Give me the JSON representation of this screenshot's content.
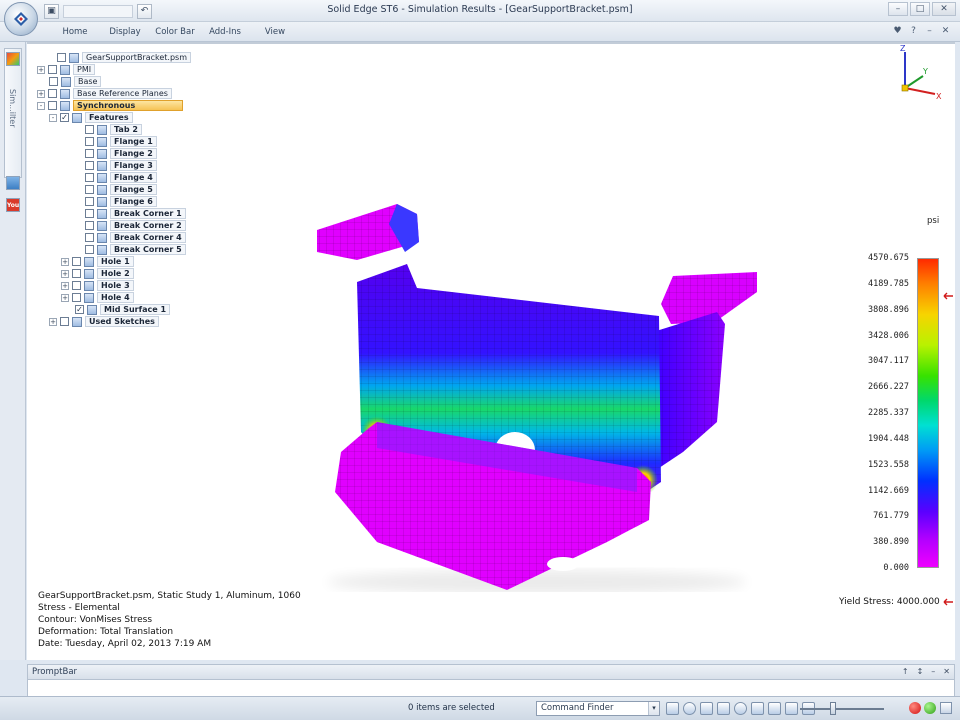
{
  "window": {
    "title": "Solid Edge ST6 - Simulation Results - [GearSupportBracket.psm]",
    "controls": [
      "–",
      "□",
      "✕"
    ]
  },
  "qat": {
    "buttons": [
      "▣",
      "↶"
    ]
  },
  "ribbon": {
    "tabs": [
      "Home",
      "Display",
      "Color Bar",
      "Add-Ins",
      "View"
    ],
    "tools": [
      "♥",
      "?",
      "–",
      "✕"
    ]
  },
  "dock": {
    "pane_label": "Sim...ilter"
  },
  "tree": {
    "items": [
      {
        "label": "GearSupportBracket.psm",
        "exp": "",
        "chk": "",
        "bold": false,
        "selected": false
      },
      {
        "label": "PMI",
        "exp": "+",
        "chk": "",
        "bold": false,
        "selected": false
      },
      {
        "label": "Base",
        "exp": "",
        "chk": "",
        "bold": false,
        "selected": false
      },
      {
        "label": "Base Reference Planes",
        "exp": "+",
        "chk": "",
        "bold": false,
        "selected": false
      },
      {
        "label": "Synchronous",
        "exp": "-",
        "chk": "",
        "bold": true,
        "selected": true
      },
      {
        "label": "Features",
        "exp": "-",
        "chk": "✓",
        "bold": true,
        "selected": false
      },
      {
        "label": "Tab 2",
        "exp": "",
        "chk": "",
        "bold": true,
        "selected": false
      },
      {
        "label": "Flange 1",
        "exp": "",
        "chk": "",
        "bold": true,
        "selected": false
      },
      {
        "label": "Flange 2",
        "exp": "",
        "chk": "",
        "bold": true,
        "selected": false
      },
      {
        "label": "Flange 3",
        "exp": "",
        "chk": "",
        "bold": true,
        "selected": false
      },
      {
        "label": "Flange 4",
        "exp": "",
        "chk": "",
        "bold": true,
        "selected": false
      },
      {
        "label": "Flange 5",
        "exp": "",
        "chk": "",
        "bold": true,
        "selected": false
      },
      {
        "label": "Flange 6",
        "exp": "",
        "chk": "",
        "bold": true,
        "selected": false
      },
      {
        "label": "Break Corner 1",
        "exp": "",
        "chk": "",
        "bold": true,
        "selected": false
      },
      {
        "label": "Break Corner 2",
        "exp": "",
        "chk": "",
        "bold": true,
        "selected": false
      },
      {
        "label": "Break Corner 4",
        "exp": "",
        "chk": "",
        "bold": true,
        "selected": false
      },
      {
        "label": "Break Corner 5",
        "exp": "",
        "chk": "",
        "bold": true,
        "selected": false
      },
      {
        "label": "Hole 1",
        "exp": "+",
        "chk": "",
        "bold": true,
        "selected": false
      },
      {
        "label": "Hole 2",
        "exp": "+",
        "chk": "",
        "bold": true,
        "selected": false
      },
      {
        "label": "Hole 3",
        "exp": "+",
        "chk": "",
        "bold": true,
        "selected": false
      },
      {
        "label": "Hole 4",
        "exp": "+",
        "chk": "",
        "bold": true,
        "selected": false
      },
      {
        "label": "Mid Surface 1",
        "exp": "",
        "chk": "✓",
        "bold": true,
        "selected": false
      },
      {
        "label": "Used Sketches",
        "exp": "+",
        "chk": "",
        "bold": true,
        "selected": false
      }
    ]
  },
  "colorbar": {
    "unit": "psi",
    "labels": [
      "4570.675",
      "4189.785",
      "3808.896",
      "3428.006",
      "3047.117",
      "2666.227",
      "2285.337",
      "1904.448",
      "1523.558",
      "1142.669",
      "761.779",
      "380.890",
      "0.000"
    ],
    "yield_stress": "Yield Stress: 4000.000",
    "marker_color": "#d11a1a",
    "top_color": "#ff2a00",
    "bottom_color": "#ee00ff"
  },
  "results": {
    "lines": [
      "GearSupportBracket.psm, Static Study 1, Aluminum, 1060",
      "Stress - Elemental",
      "Contour: VonMises Stress",
      "Deformation: Total Translation",
      "Date: Tuesday, April 02, 2013  7:19 AM"
    ]
  },
  "triad": {
    "axes": [
      "Z",
      "Y",
      "X"
    ]
  },
  "promptbar": {
    "label": "PromptBar",
    "tools": [
      "↑",
      "↕",
      "–",
      "✕"
    ]
  },
  "status": {
    "text": "0 items are selected",
    "command_finder": "Command Finder",
    "command_finder_arrow": "▾"
  }
}
